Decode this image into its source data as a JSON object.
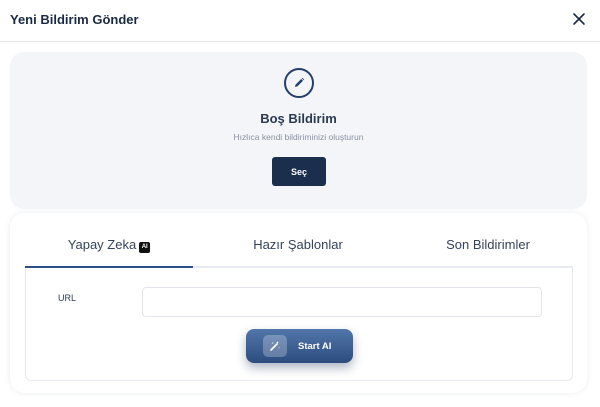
{
  "modal": {
    "title": "Yeni Bildirim Gönder"
  },
  "blank_notification": {
    "title": "Boş Bildirim",
    "subtitle": "Hızlıca kendi bildiriminizi oluşturun",
    "select_label": "Seç"
  },
  "tabs": [
    {
      "label": "Yapay Zeka",
      "badge": "AI",
      "active": true
    },
    {
      "label": "Hazır Şablonlar",
      "active": false
    },
    {
      "label": "Son Bildirimler",
      "active": false
    }
  ],
  "form": {
    "url_label": "URL",
    "url_value": "",
    "start_ai_label": "Start AI"
  },
  "icons": {
    "close": "close-icon",
    "edit": "pencil-icon",
    "wand": "magic-wand-icon"
  },
  "colors": {
    "primary_dark": "#1b2e4d",
    "accent": "#2c4f85",
    "card_bg": "#f3f5f9"
  }
}
